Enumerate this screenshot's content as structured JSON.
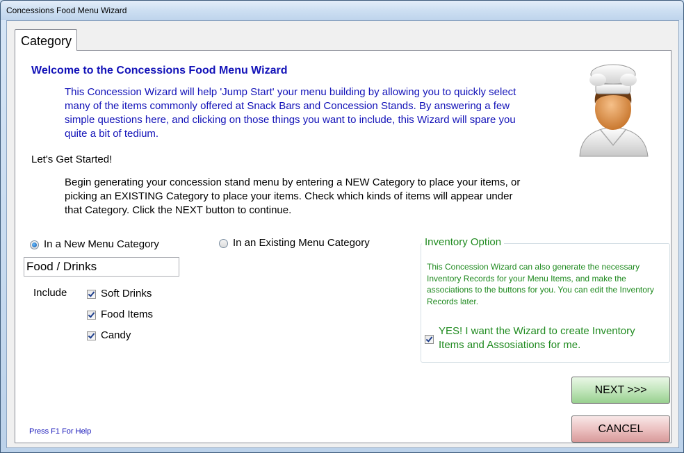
{
  "window": {
    "title": "Concessions Food Menu Wizard"
  },
  "tab": {
    "label": "Category"
  },
  "welcome": {
    "heading": "Welcome to the Concessions Food Menu Wizard"
  },
  "intro": {
    "text": "This Concession Wizard will help 'Jump Start' your menu building by allowing you to quickly select many of the items commonly offered at Snack Bars and Concession Stands.  By answering a few simple questions here, and clicking on those things you want to include, this Wizard will spare you quite a bit of tedium."
  },
  "get_started": {
    "heading": "Let's Get Started!",
    "text": "Begin generating your concession stand menu by entering a NEW Category to place your items, or picking an EXISTING Category to place your items.  Check which kinds of items will appear under that Category.  Click the NEXT button to continue."
  },
  "category_options": {
    "new_label": "In a New Menu Category",
    "existing_label": "In an Existing Menu Category",
    "selected": "new"
  },
  "category_name": {
    "value": "Food / Drinks"
  },
  "include": {
    "label": "Include",
    "items": [
      {
        "label": "Soft Drinks",
        "checked": true
      },
      {
        "label": "Food Items",
        "checked": true
      },
      {
        "label": "Candy",
        "checked": true
      }
    ]
  },
  "inventory": {
    "legend": "Inventory Option",
    "description": "This Concession Wizard can also generate the necessary Inventory Records for your Menu Items, and make the associations to the buttons for you. You can edit the Inventory Records later.",
    "checkbox_label": "YES!  I want the Wizard to create Inventory Items and Assosiations for me.",
    "checked": true
  },
  "buttons": {
    "next": "NEXT >>>",
    "cancel": "CANCEL"
  },
  "help": {
    "text": "Press F1 For Help"
  },
  "colors": {
    "accent_blue": "#1212b8",
    "accent_green": "#1f8a1f",
    "next_green": "#98d08f",
    "cancel_red": "#d89a9a"
  },
  "icons": {
    "chef": "chef-avatar-icon"
  }
}
